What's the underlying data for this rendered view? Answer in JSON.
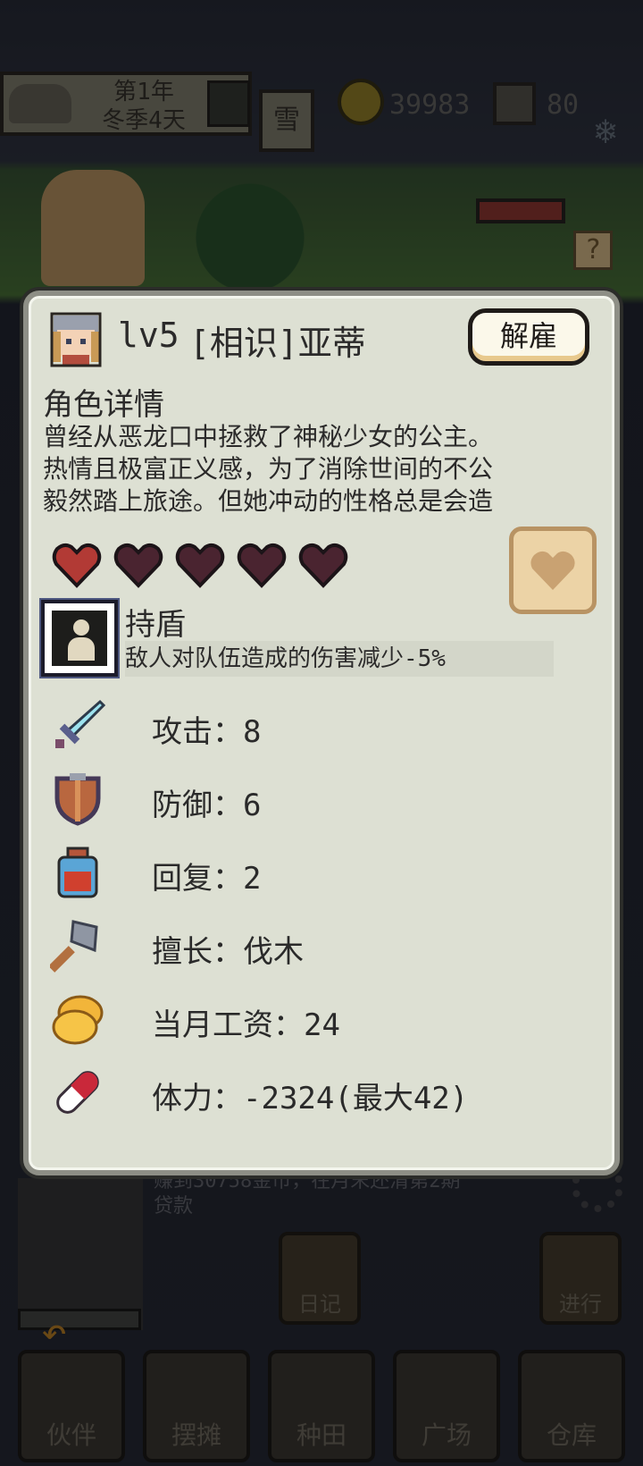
{
  "top_bar": {
    "year": "第1年",
    "season_day": "冬季4天",
    "weather": "雪",
    "coins": "39983",
    "gems": "80"
  },
  "dialog": {
    "level": "lv5",
    "name": "[相识]亚蒂",
    "dismiss_label": "解雇",
    "section_title": "角色详情",
    "description_lines": [
      "曾经从恶龙口中拯救了神秘少女的公主。",
      "热情且极富正义感，为了消除世间的不公",
      "毅然踏上旅途。但她冲动的性格总是会造"
    ],
    "affection": {
      "filled": 1,
      "total": 5
    },
    "skill": {
      "name": "持盾",
      "description": "敌人对队伍造成的伤害减少-5%"
    },
    "stats": [
      {
        "icon": "sword-icon",
        "label": "攻击：8"
      },
      {
        "icon": "shield-icon",
        "label": "防御：6"
      },
      {
        "icon": "potion-icon",
        "label": "回复：2"
      },
      {
        "icon": "axe-icon",
        "label": "擅长：伐木"
      },
      {
        "icon": "gold-coins-icon",
        "label": "当月工资：24"
      },
      {
        "icon": "stamina-pill-icon",
        "label": "体力：-2324(最大42)"
      }
    ]
  },
  "background": {
    "log_line1": "赚到30758金币，在月末还清第2期",
    "log_line2": "贷款",
    "diary_label": "日记",
    "proceed_label": "进行"
  },
  "bottom_nav": [
    {
      "label": "伙伴"
    },
    {
      "label": "摆摊"
    },
    {
      "label": "种田"
    },
    {
      "label": "广场"
    },
    {
      "label": "仓库"
    }
  ],
  "colors": {
    "dialog_bg": "#dde0d3",
    "heart_filled": "#b23a35",
    "heart_empty": "#4a2430",
    "button_border": "#1f1b18"
  }
}
